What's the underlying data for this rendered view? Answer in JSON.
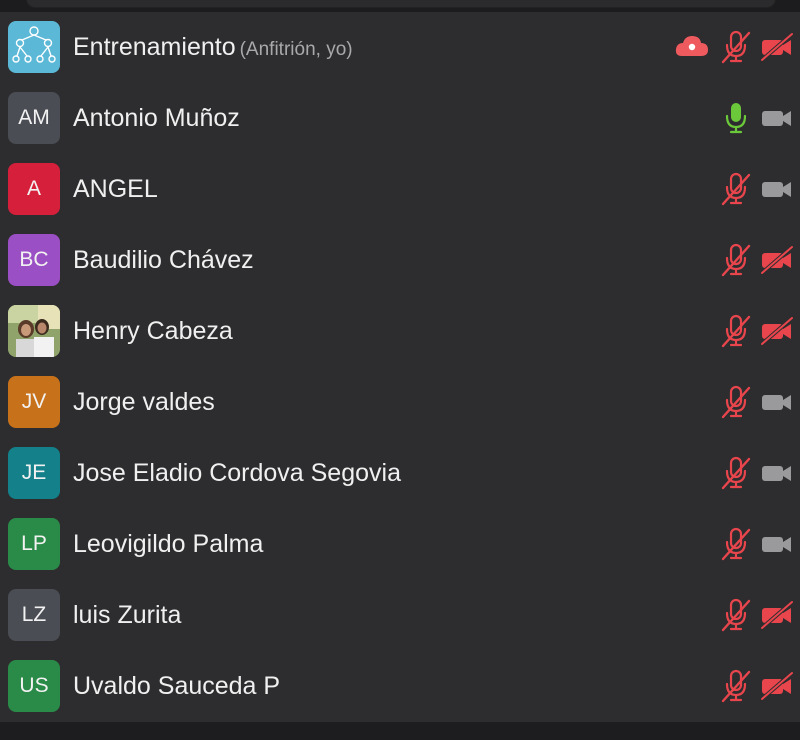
{
  "participants": [
    {
      "initials": "",
      "name": "Entrenamiento",
      "tag": "(Anfitrión, yo)",
      "avatar_color": "#5bb8d6",
      "avatar_kind": "logo",
      "mic": "muted",
      "cam": "off",
      "cloud": true
    },
    {
      "initials": "AM",
      "name": "Antonio Muñoz",
      "tag": "",
      "avatar_color": "#4a4d54",
      "avatar_kind": "initials",
      "mic": "on",
      "cam": "on",
      "cloud": false
    },
    {
      "initials": "A",
      "name": "ANGEL",
      "tag": "",
      "avatar_color": "#d61f3a",
      "avatar_kind": "initials",
      "mic": "muted",
      "cam": "on",
      "cloud": false
    },
    {
      "initials": "BC",
      "name": "Baudilio Chávez",
      "tag": "",
      "avatar_color": "#9a4fc4",
      "avatar_kind": "initials",
      "mic": "muted",
      "cam": "off",
      "cloud": false
    },
    {
      "initials": "",
      "name": "Henry Cabeza",
      "tag": "",
      "avatar_color": "#6a7f54",
      "avatar_kind": "photo",
      "mic": "muted",
      "cam": "off",
      "cloud": false
    },
    {
      "initials": "JV",
      "name": "Jorge valdes",
      "tag": "",
      "avatar_color": "#c7721a",
      "avatar_kind": "initials",
      "mic": "muted",
      "cam": "on",
      "cloud": false
    },
    {
      "initials": "JE",
      "name": "Jose Eladio Cordova Segovia",
      "tag": "",
      "avatar_color": "#13808a",
      "avatar_kind": "initials",
      "mic": "muted",
      "cam": "on",
      "cloud": false
    },
    {
      "initials": "LP",
      "name": "Leovigildo Palma",
      "tag": "",
      "avatar_color": "#2a8a47",
      "avatar_kind": "initials",
      "mic": "muted",
      "cam": "on",
      "cloud": false
    },
    {
      "initials": "LZ",
      "name": "luis Zurita",
      "tag": "",
      "avatar_color": "#4a4d54",
      "avatar_kind": "initials",
      "mic": "muted",
      "cam": "off",
      "cloud": false
    },
    {
      "initials": "US",
      "name": "Uvaldo Sauceda P",
      "tag": "",
      "avatar_color": "#2a8a47",
      "avatar_kind": "initials",
      "mic": "muted",
      "cam": "off",
      "cloud": false
    }
  ],
  "colors": {
    "muted_red": "#e8454c",
    "mic_green": "#6bc83a",
    "cam_gray": "#9a9a9c",
    "cloud_red": "#ef5a5f"
  },
  "icons": {
    "cloud": "cloud-recording-icon",
    "mic_on": "microphone-icon",
    "mic_muted": "microphone-muted-icon",
    "cam_on": "video-camera-icon",
    "cam_off": "video-camera-off-icon"
  }
}
